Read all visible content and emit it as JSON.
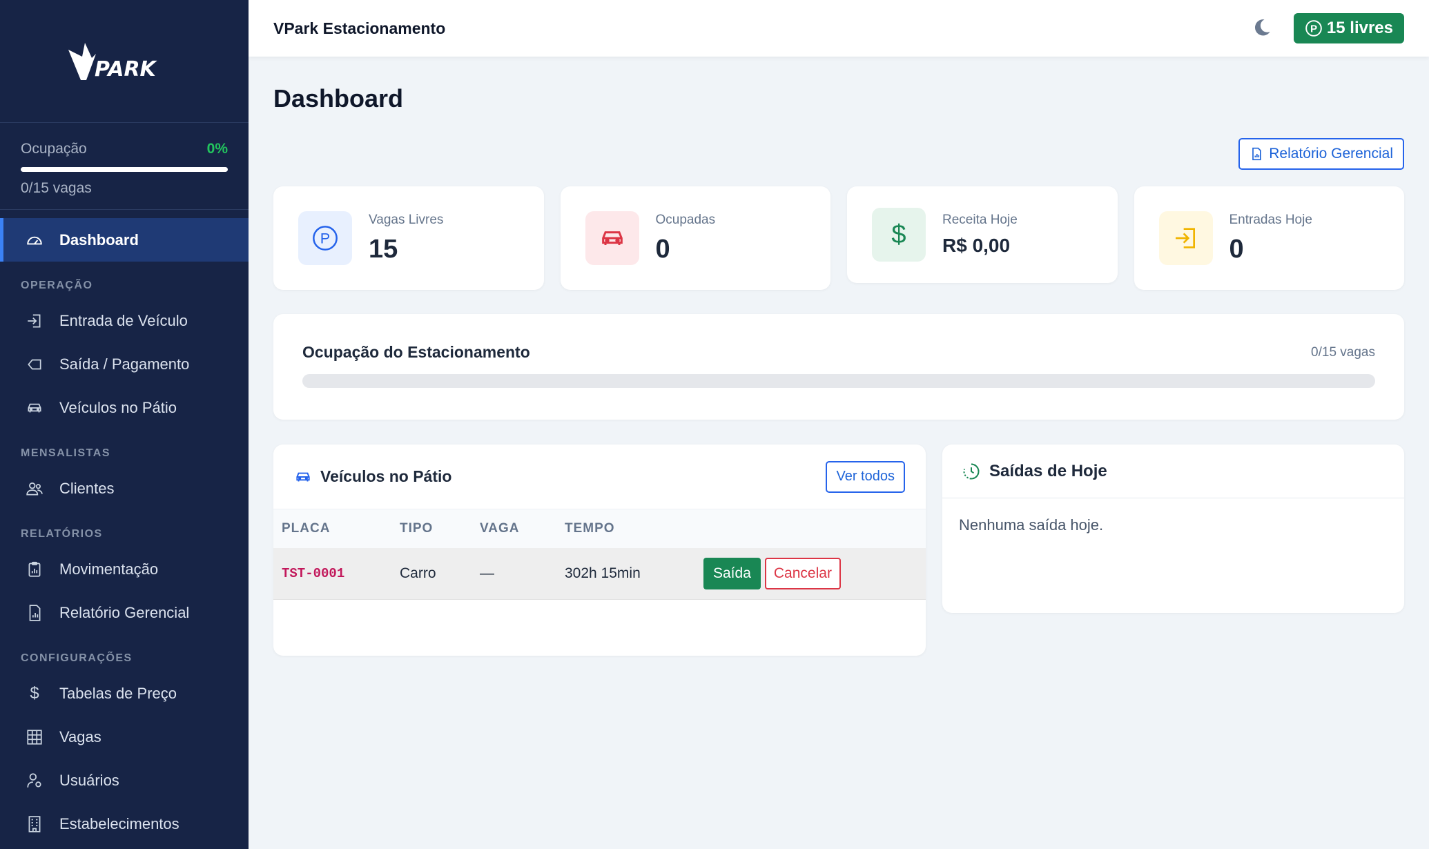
{
  "brand": {
    "logo_text": "VPARK"
  },
  "sidebar": {
    "occupancy": {
      "label": "Ocupação",
      "percent": "0%",
      "vagas": "0/15 vagas",
      "fill_fraction": 0
    },
    "active_item": {
      "label": "Dashboard",
      "icon": "gauge-icon"
    },
    "sections": [
      {
        "title": "OPERAÇÃO",
        "items": [
          {
            "label": "Entrada de Veículo",
            "icon": "login-icon"
          },
          {
            "label": "Saída / Pagamento",
            "icon": "logout-icon"
          },
          {
            "label": "Veículos no Pátio",
            "icon": "car-icon"
          }
        ]
      },
      {
        "title": "MENSALISTAS",
        "items": [
          {
            "label": "Clientes",
            "icon": "people-icon"
          }
        ]
      },
      {
        "title": "RELATÓRIOS",
        "items": [
          {
            "label": "Movimentação",
            "icon": "clipboard-chart-icon"
          },
          {
            "label": "Relatório Gerencial",
            "icon": "file-chart-icon"
          }
        ]
      },
      {
        "title": "CONFIGURAÇÕES",
        "items": [
          {
            "label": "Tabelas de Preço",
            "icon": "dollar-icon"
          },
          {
            "label": "Vagas",
            "icon": "grid-icon"
          },
          {
            "label": "Usuários",
            "icon": "user-gear-icon"
          },
          {
            "label": "Estabelecimentos",
            "icon": "building-icon"
          }
        ]
      }
    ]
  },
  "topbar": {
    "title": "VPark Estacionamento",
    "free_badge": "15 livres",
    "theme_icon": "moon-icon"
  },
  "main": {
    "page_title": "Dashboard",
    "report_button": "Relatório Gerencial",
    "cards": [
      {
        "label": "Vagas Livres",
        "value": "15",
        "icon": "parking-icon",
        "color": "#2563eb",
        "bg": "#e8f0fe"
      },
      {
        "label": "Ocupadas",
        "value": "0",
        "icon": "car-front-icon",
        "color": "#dc3545",
        "bg": "#fde8ea"
      },
      {
        "label": "Receita Hoje",
        "value": "R$ 0,00",
        "icon": "dollar-icon",
        "color": "#198754",
        "bg": "#e6f4ec"
      },
      {
        "label": "Entradas Hoje",
        "value": "0",
        "icon": "login-icon",
        "color": "#f0b400",
        "bg": "#fff8e1"
      }
    ],
    "occupancy_panel": {
      "title": "Ocupação do Estacionamento",
      "vagas": "0/15 vagas",
      "fill_fraction": 0
    },
    "vehicles": {
      "title": "Veículos no Pátio",
      "view_all": "Ver todos",
      "columns": [
        "PLACA",
        "TIPO",
        "VAGA",
        "TEMPO"
      ],
      "rows": [
        {
          "plate": "TST-0001",
          "type": "Carro",
          "spot": "—",
          "time": "302h 15min",
          "exit_label": "Saída",
          "cancel_label": "Cancelar"
        }
      ]
    },
    "exits": {
      "title": "Saídas de Hoje",
      "empty": "Nenhuma saída hoje."
    }
  }
}
